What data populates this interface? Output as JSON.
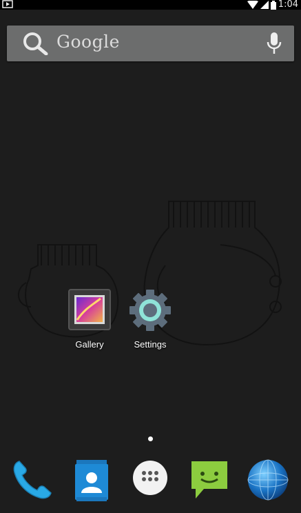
{
  "status_bar": {
    "time": "1:04"
  },
  "search": {
    "label": "Google"
  },
  "home": {
    "apps": [
      {
        "label": "Gallery"
      },
      {
        "label": "Settings"
      }
    ]
  },
  "dock": {
    "items": [
      "phone-icon",
      "contacts-icon",
      "all-apps-icon",
      "messaging-icon",
      "browser-icon"
    ]
  },
  "colors": {
    "accent": "#8ccc3f",
    "phone": "#29a9e6",
    "contacts": "#1e8ad6"
  }
}
